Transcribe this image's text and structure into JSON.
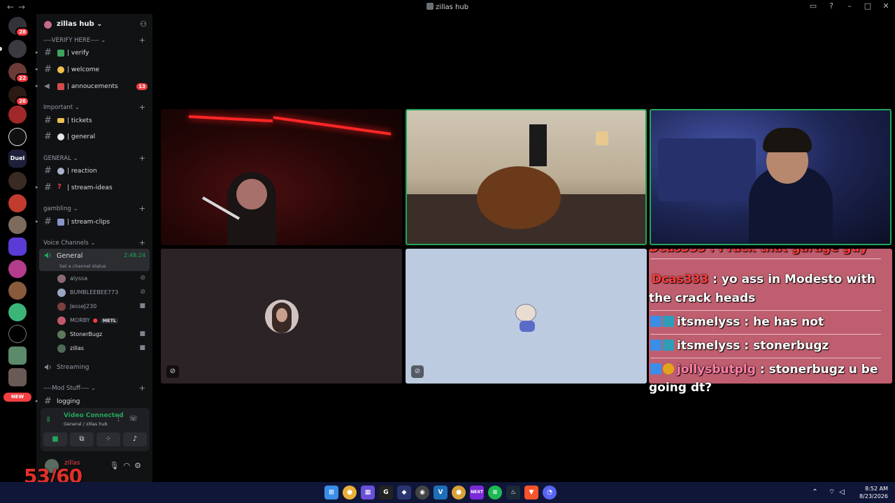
{
  "window": {
    "title": "zillas hub"
  },
  "rail": {
    "badges": [
      "28",
      "22",
      "26"
    ],
    "duel_label": "Duel",
    "new_label": "NEW"
  },
  "server": {
    "name": "zillas hub"
  },
  "categories": {
    "verify": "----VERIFY HERE----",
    "important": "Important",
    "general": "GENERAL",
    "gambling": "gambling",
    "voice": "Voice Channels",
    "mod": "----Mod Stuff----"
  },
  "channels": {
    "verify": "| verify",
    "welcome": "| welcome",
    "annoucements": "| annoucements",
    "annoucements_badge": "13",
    "tickets": "| tickets",
    "general": "| general",
    "reaction": "| reaction",
    "stream_ideas": "| stream-ideas",
    "stream_clips": "| stream-clips",
    "voice_general": "General",
    "voice_general_timer": "2:48:24",
    "voice_general_status": "Set a channel status",
    "streaming": "Streaming",
    "logging": "logging"
  },
  "voice_users": [
    {
      "name": "alyssa",
      "color": "#8a6a72"
    },
    {
      "name": "BUMBLEEBEE773",
      "color": "#9aa7c0"
    },
    {
      "name": "JesseJ230",
      "color": "#7a3f3f"
    },
    {
      "name": "MORBY",
      "color": "#c05a6a",
      "tag": "METL"
    },
    {
      "name": "StonerBugz",
      "color": "#5a7a5a"
    },
    {
      "name": "zillas",
      "color": "#4f6b58"
    }
  ],
  "voice_panel": {
    "status": "Video Connected",
    "location": "General / zillas hub"
  },
  "user_panel": {
    "username": "zillas"
  },
  "overlay": {
    "fps": "53/60"
  },
  "chat": {
    "partial": "Dcas333 : i fuck that garage guy",
    "messages": [
      {
        "user": "Dcas333",
        "text": " : yo ass in Modesto with the crack heads",
        "color": "#ff3b3b"
      },
      {
        "user": "itsmelyss",
        "text": " : he has not",
        "color": "#ffffff"
      },
      {
        "user": "itsmelyss",
        "text": " : stonerbugz",
        "color": "#ffffff"
      },
      {
        "user": "jollysbutplg",
        "text": " : stonerbugz u be",
        "color": "#ff7ea6"
      }
    ],
    "overflow": "going dt?"
  },
  "taskbar": {
    "time": "8:52 AM",
    "date": "8/23/2026",
    "next_label": "NEXT",
    "accent": "#101638"
  }
}
